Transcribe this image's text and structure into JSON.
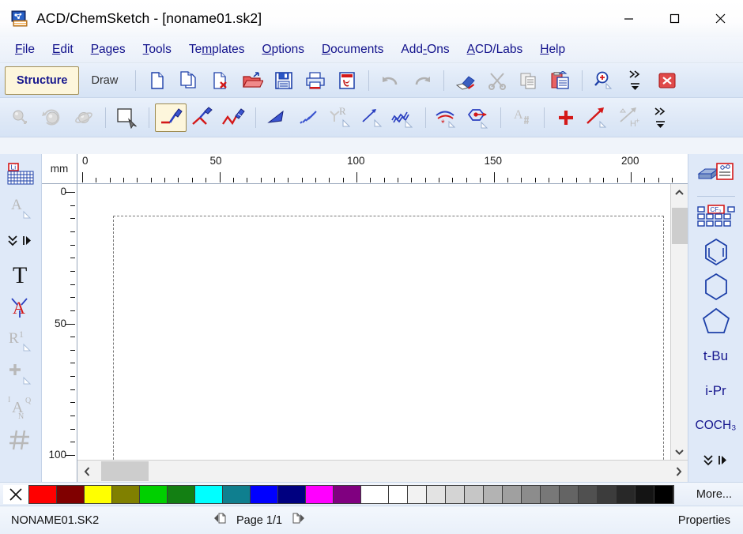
{
  "window": {
    "title": "ACD/ChemSketch - [noname01.sk2]",
    "app_icon": "chemsketch-app-icon",
    "controls": {
      "minimize": "–",
      "maximize": "□",
      "close": "✕"
    }
  },
  "menu": {
    "items": [
      {
        "label": "File",
        "accel": "F"
      },
      {
        "label": "Edit",
        "accel": "E"
      },
      {
        "label": "Pages",
        "accel": "P"
      },
      {
        "label": "Tools",
        "accel": "T"
      },
      {
        "label": "Templates",
        "accel": "m"
      },
      {
        "label": "Options",
        "accel": "O"
      },
      {
        "label": "Documents",
        "accel": "D"
      },
      {
        "label": "Add-Ons",
        "accel": "-"
      },
      {
        "label": "ACD/Labs",
        "accel": "A"
      },
      {
        "label": "Help",
        "accel": "H"
      }
    ]
  },
  "mode_bar": {
    "structure_label": "Structure",
    "draw_label": "Draw",
    "selected": "Structure"
  },
  "toolbar_main": {
    "buttons": [
      {
        "name": "new-document-icon",
        "title": "New Document"
      },
      {
        "name": "new-page-icon",
        "title": "New Page"
      },
      {
        "name": "delete-page-icon",
        "title": "Delete Page"
      },
      {
        "name": "open-folder-icon",
        "title": "Open"
      },
      {
        "name": "save-icon",
        "title": "Save"
      },
      {
        "name": "print-icon",
        "title": "Print"
      },
      {
        "name": "export-pdf-icon",
        "title": "Export to PDF"
      },
      {
        "name": "undo-icon",
        "title": "Undo"
      },
      {
        "name": "redo-icon",
        "title": "Redo"
      },
      {
        "name": "eraser-icon",
        "title": "Erase"
      },
      {
        "name": "cut-scissors-icon",
        "title": "Cut"
      },
      {
        "name": "copy-icon",
        "title": "Copy"
      },
      {
        "name": "paste-icon",
        "title": "Paste"
      },
      {
        "name": "zoom-in-icon",
        "title": "Zoom In"
      },
      {
        "name": "toolbar-overflow-icon",
        "title": "More Buttons"
      },
      {
        "name": "close-document-icon",
        "title": "Close"
      }
    ]
  },
  "toolbar_draw": {
    "buttons": [
      {
        "name": "atom-3d-rotate-icon",
        "title": "3D Rotate"
      },
      {
        "name": "optimize-3d-icon",
        "title": "3D Optimization"
      },
      {
        "name": "clean-structure-icon",
        "title": "Clean Structure"
      },
      {
        "name": "select-lasso-icon",
        "title": "Select/Move"
      },
      {
        "name": "draw-normal-bond-icon",
        "title": "Draw Normal"
      },
      {
        "name": "draw-chain-icon",
        "title": "Draw Chains"
      },
      {
        "name": "draw-continuous-icon",
        "title": "Draw Continuous"
      },
      {
        "name": "bond-wedge-up-icon",
        "title": "Up Stereo Bond"
      },
      {
        "name": "bond-wedge-down-icon",
        "title": "Down Stereo Bond"
      },
      {
        "name": "r-group-icon",
        "title": "R-Group"
      },
      {
        "name": "arrow-bond-icon",
        "title": "Arrow"
      },
      {
        "name": "polymer-bond-icon",
        "title": "Polymer Bond"
      },
      {
        "name": "aromatic-ring-icon",
        "title": "Aromatic"
      },
      {
        "name": "cyclize-icon",
        "title": "Cyclize"
      },
      {
        "name": "atom-label-icon",
        "title": "Atom Label"
      },
      {
        "name": "add-plus-icon",
        "title": "Plus Sign"
      },
      {
        "name": "reaction-arrow-icon",
        "title": "Reaction Arrow"
      },
      {
        "name": "charge-h-icon",
        "title": "Add Charge / H"
      },
      {
        "name": "toolbar-overflow-icon",
        "title": "More Buttons"
      }
    ],
    "active": "draw-normal-bond-icon"
  },
  "left_toolbar": {
    "buttons": [
      {
        "name": "periodic-table-icon",
        "label": "Li",
        "title": "Periodic Table"
      },
      {
        "name": "atom-symbol-icon",
        "label": "A",
        "title": "Atom Symbol"
      },
      {
        "name": "expand-collapse-icon",
        "label": "",
        "title": "More Atoms"
      },
      {
        "name": "text-tool-icon",
        "label": "T",
        "title": "Text Tool"
      },
      {
        "name": "atom-label-edit-icon",
        "label": "A",
        "title": "Edit Atom Label"
      },
      {
        "name": "r-superscript-icon",
        "label": "R1",
        "title": "R-Group Label"
      },
      {
        "name": "charge-plus-icon",
        "label": "+",
        "title": "Increase Charge"
      },
      {
        "name": "isotope-icon",
        "label": "A",
        "title": "Isotope / Charge"
      },
      {
        "name": "grid-hash-icon",
        "label": "#",
        "title": "Grid"
      }
    ]
  },
  "right_toolbar": {
    "buttons": [
      {
        "name": "templates-window-icon",
        "label": "",
        "title": "Template Window"
      },
      {
        "name": "radical-table-icon",
        "label": "CF₃",
        "title": "Table of Radicals"
      },
      {
        "name": "benzene-ring-icon",
        "label": "",
        "title": "Benzene"
      },
      {
        "name": "cyclohexane-ring-icon",
        "label": "",
        "title": "Cyclohexane"
      },
      {
        "name": "cyclopentane-ring-icon",
        "label": "",
        "title": "Cyclopentane"
      },
      {
        "name": "tbu-group-button",
        "label": "t-Bu",
        "title": "tert-Butyl"
      },
      {
        "name": "ipr-group-button",
        "label": "i-Pr",
        "title": "isopropyl"
      },
      {
        "name": "coch3-group-button",
        "label": "COCH₃",
        "title": "Acetyl"
      },
      {
        "name": "expand-collapse-icon",
        "label": "",
        "title": "More Templates"
      }
    ]
  },
  "canvas": {
    "unit_label": "mm",
    "h_ruler": {
      "major_labels": [
        "0",
        "50",
        "100",
        "150",
        "200"
      ],
      "major_values": [
        0,
        50,
        100,
        150,
        200
      ],
      "minor_step": 5,
      "max": 215
    },
    "v_ruler": {
      "major_labels": [
        "0",
        "50",
        "100"
      ],
      "major_values": [
        0,
        50,
        100
      ],
      "minor_step": 5,
      "max": 108
    }
  },
  "scrollbars": {
    "vertical": {
      "up": "˄",
      "down": "˅"
    },
    "horizontal": {
      "left": "‹",
      "right": "›"
    }
  },
  "palette": {
    "no_color_label": "✕",
    "more_label": "More...",
    "colors": [
      "#ff0000",
      "#800000",
      "#ffff00",
      "#808000",
      "#00d000",
      "#137f13",
      "#00ffff",
      "#0f7f8f",
      "#0000ff",
      "#000080",
      "#ff00ff",
      "#800080",
      "#ffffff"
    ],
    "grays": [
      "#ffffff",
      "#f2f2f2",
      "#e3e3e3",
      "#d4d4d4",
      "#c6c6c6",
      "#b3b3b3",
      "#a0a0a0",
      "#8c8c8c",
      "#787878",
      "#646464",
      "#505050",
      "#3c3c3c",
      "#282828",
      "#141414",
      "#000000"
    ]
  },
  "status_bar": {
    "filename": "NONAME01.SK2",
    "page_label": "Page 1/1",
    "prev_page_icon": "previous-page-icon",
    "next_page_icon": "next-page-icon",
    "properties_label": "Properties"
  },
  "theme": {
    "menu_text": "#12128c",
    "toolbar_bg": "#dfe9f8",
    "accent_blue": "#16168e",
    "accent_red": "#cc0000",
    "selected_bg": "#fdf6dc"
  }
}
